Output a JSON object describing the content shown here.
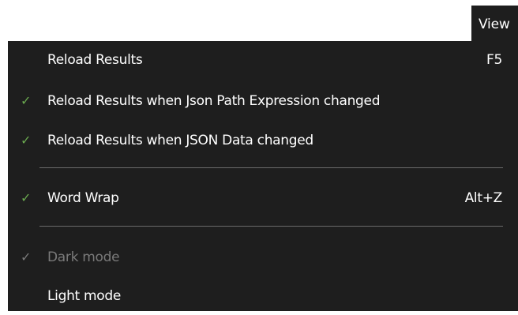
{
  "menubar": {
    "view_label": "View"
  },
  "menu": {
    "items": [
      {
        "label": "Reload Results",
        "shortcut": "F5",
        "checked": false,
        "enabled": true
      },
      {
        "label": "Reload Results when Json Path Expression changed",
        "shortcut": "",
        "checked": true,
        "enabled": true
      },
      {
        "label": "Reload Results when JSON Data changed",
        "shortcut": "",
        "checked": true,
        "enabled": true
      },
      {
        "label": "Word Wrap",
        "shortcut": "Alt+Z",
        "checked": true,
        "enabled": true
      },
      {
        "label": "Dark mode",
        "shortcut": "",
        "checked": true,
        "enabled": false
      },
      {
        "label": "Light mode",
        "shortcut": "",
        "checked": false,
        "enabled": true
      }
    ],
    "check_glyph": "✓"
  },
  "colors": {
    "menu_background": "#1e1e1e",
    "text": "#ffffff",
    "disabled_text": "#7a7a7a",
    "check": "#6aa84f",
    "separator": "#6a6a6a"
  }
}
